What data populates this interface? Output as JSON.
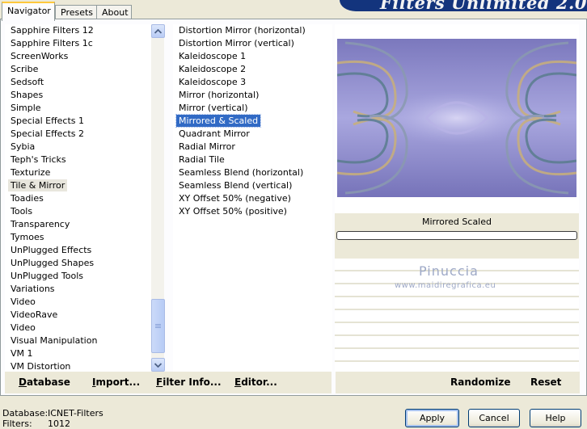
{
  "tabs": [
    {
      "label": "Navigator",
      "active": true
    },
    {
      "label": "Presets",
      "active": false
    },
    {
      "label": "About",
      "active": false
    }
  ],
  "banner_title": "Filters Unlimited 2.0",
  "categories": {
    "items": [
      "Sapphire Filters 12",
      "Sapphire Filters 1c",
      "ScreenWorks",
      "Scribe",
      "Sedsoft",
      "Shapes",
      "Simple",
      "Special Effects 1",
      "Special Effects 2",
      "Sybia",
      "Teph's Tricks",
      "Texturize",
      "Tile & Mirror",
      "Toadies",
      "Tools",
      "Transparency",
      "Tymoes",
      "UnPlugged Effects",
      "UnPlugged Shapes",
      "UnPlugged Tools",
      "Variations",
      "Video",
      "VideoRave",
      "Video",
      "Visual Manipulation",
      "VM 1",
      "VM Distortion"
    ],
    "selected_index": 12
  },
  "filters": {
    "items": [
      "Distortion Mirror (horizontal)",
      "Distortion Mirror (vertical)",
      "Kaleidoscope 1",
      "Kaleidoscope 2",
      "Kaleidoscope 3",
      "Mirror (horizontal)",
      "Mirror (vertical)",
      "Mirrored & Scaled",
      "Quadrant Mirror",
      "Radial Mirror",
      "Radial Tile",
      "Seamless Blend (horizontal)",
      "Seamless Blend (vertical)",
      "XY Offset 50% (negative)",
      "XY Offset 50% (positive)"
    ],
    "selected_index": 7
  },
  "preview": {
    "effect_name": "Mirrored  Scaled",
    "progress": 0,
    "watermark_name": "Pinuccia",
    "watermark_url": "www.maidiregrafica.eu"
  },
  "button_bar": {
    "database": "Database",
    "import": "Import...",
    "filter_info": "Filter Info...",
    "editor": "Editor...",
    "randomize": "Randomize",
    "reset": "Reset"
  },
  "status": {
    "database_label": "Database:",
    "database_value": "ICNET-Filters",
    "filters_label": "Filters:",
    "filters_value": "1012"
  },
  "dialog_buttons": {
    "apply": "Apply",
    "cancel": "Cancel",
    "help": "Help"
  },
  "colors": {
    "selection_blue": "#316ac5",
    "selection_gray": "#e8e6dd",
    "banner": "#13347d",
    "face": "#ece9d8"
  },
  "icons": {
    "scroll_up": "chevron-up-icon",
    "scroll_down": "chevron-down-icon"
  }
}
